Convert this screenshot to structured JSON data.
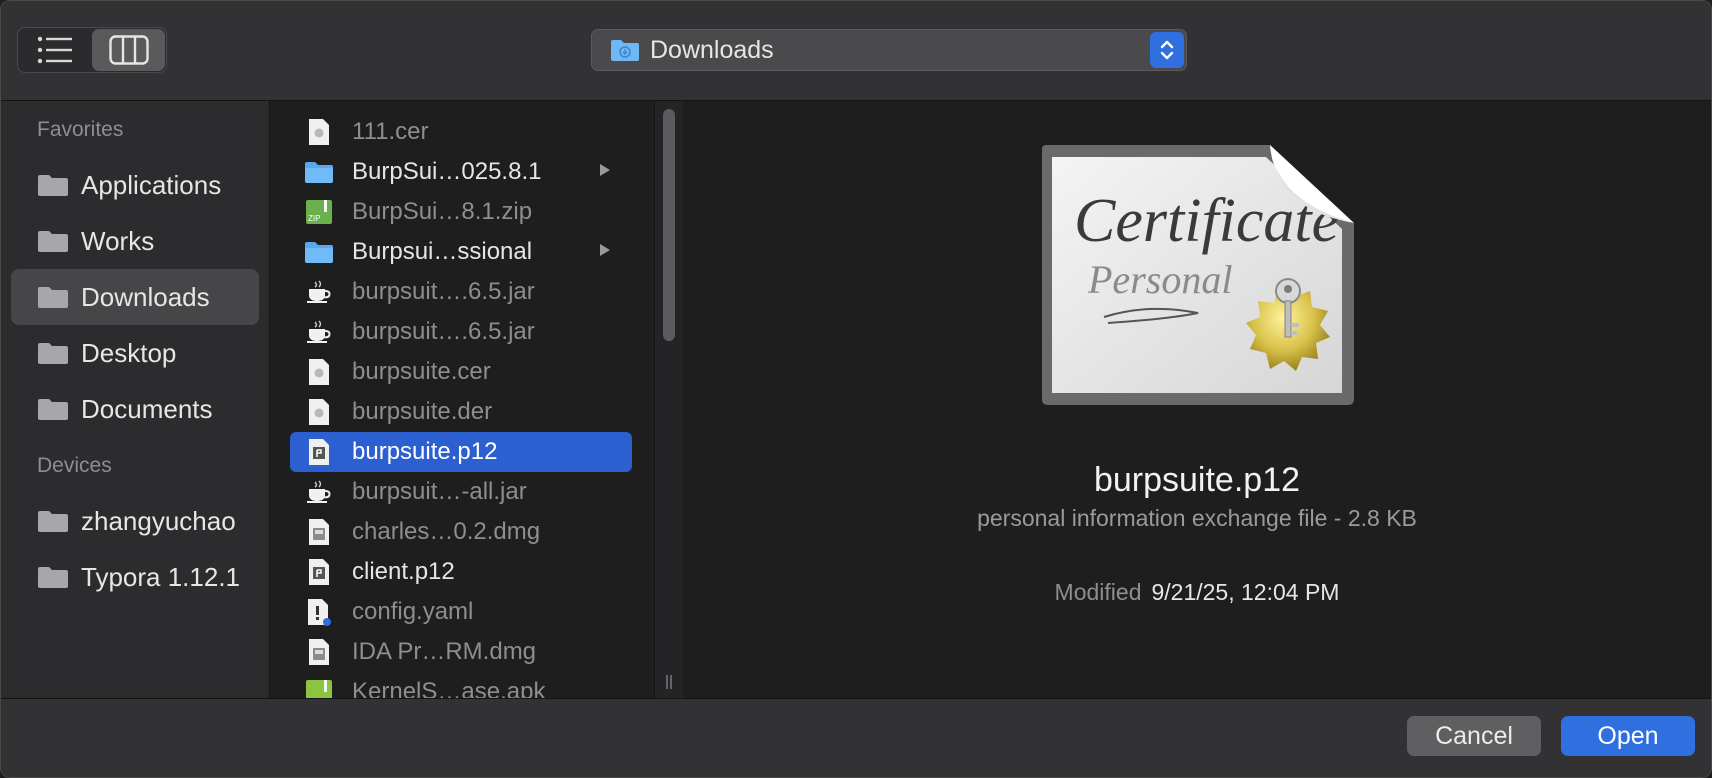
{
  "toolbar": {
    "location": "Downloads",
    "view_list_icon": "list-view-icon",
    "view_column_icon": "column-view-icon"
  },
  "sidebar": {
    "favorites_header": "Favorites",
    "favorites": [
      {
        "label": "Applications"
      },
      {
        "label": "Works"
      },
      {
        "label": "Downloads",
        "selected": true
      },
      {
        "label": "Desktop"
      },
      {
        "label": "Documents"
      }
    ],
    "devices_header": "Devices",
    "devices": [
      {
        "label": "zhangyuchao"
      },
      {
        "label": "Typora 1.12.1"
      }
    ]
  },
  "files": [
    {
      "name": "111.cer",
      "icon": "certificate-file-icon"
    },
    {
      "name": "BurpSui…025.8.1",
      "icon": "folder-icon",
      "folder": true
    },
    {
      "name": "BurpSui…8.1.zip",
      "icon": "zip-file-icon"
    },
    {
      "name": "Burpsui…ssional",
      "icon": "folder-icon",
      "folder": true
    },
    {
      "name": "burpsuit….6.5.jar",
      "icon": "java-jar-icon"
    },
    {
      "name": "burpsuit….6.5.jar",
      "icon": "java-jar-icon"
    },
    {
      "name": "burpsuite.cer",
      "icon": "certificate-file-icon"
    },
    {
      "name": "burpsuite.der",
      "icon": "certificate-file-icon"
    },
    {
      "name": "burpsuite.p12",
      "icon": "p12-file-icon",
      "selected": true
    },
    {
      "name": "burpsuit…-all.jar",
      "icon": "java-jar-icon"
    },
    {
      "name": "charles…0.2.dmg",
      "icon": "disk-image-icon"
    },
    {
      "name": "client.p12",
      "icon": "p12-file-icon",
      "bright": true
    },
    {
      "name": "config.yaml",
      "icon": "yaml-file-icon"
    },
    {
      "name": "IDA Pr…RM.dmg",
      "icon": "disk-image-icon"
    },
    {
      "name": "KernelS…ase.apk",
      "icon": "apk-file-icon"
    }
  ],
  "preview": {
    "file_name": "burpsuite.p12",
    "kind": "personal information exchange file - 2.8 KB",
    "modified_label": "Modified",
    "modified_value": "9/21/25, 12:04 PM",
    "certificate_word": "Certificate",
    "personal_word": "Personal"
  },
  "buttons": {
    "cancel": "Cancel",
    "open": "Open"
  },
  "colors": {
    "accent": "#2f6fe0",
    "selection": "#2c5fcf",
    "folder": "#5aa9f0"
  }
}
